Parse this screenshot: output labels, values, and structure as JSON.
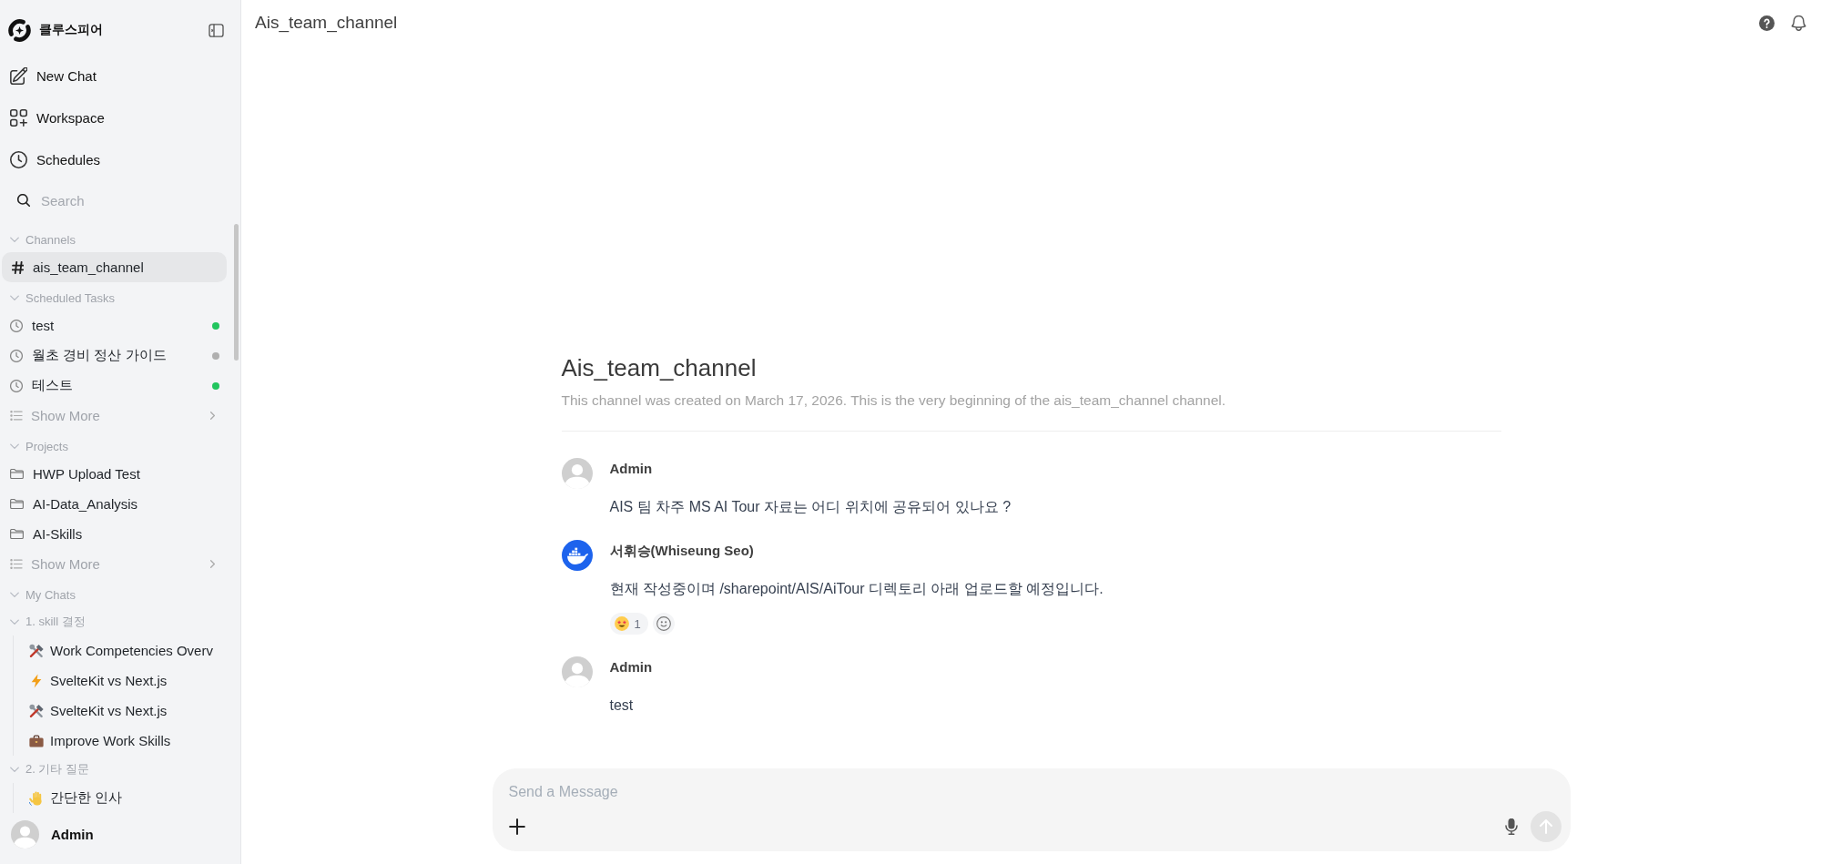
{
  "sidebar": {
    "brand": "클루스피어",
    "nav": [
      {
        "label": "New Chat",
        "kind": "new_chat"
      },
      {
        "label": "Workspace",
        "kind": "workspace"
      },
      {
        "label": "Schedules",
        "kind": "schedules"
      }
    ],
    "search": {
      "placeholder": "Search"
    },
    "sections": [
      {
        "kind": "channels",
        "title": "Channels",
        "expanded": true,
        "items": [
          {
            "label": "ais_team_channel",
            "selected": true
          }
        ]
      },
      {
        "kind": "tasks",
        "title": "Scheduled Tasks",
        "expanded": true,
        "items": [
          {
            "label": "test",
            "color": "#22c55e",
            "selected": false
          },
          {
            "label": "월초 경비 정산 가이드",
            "color": "#b0b0b0",
            "selected": false
          },
          {
            "label": "테스트",
            "color": "#22c55e",
            "selected": false
          }
        ],
        "more": "Show More"
      },
      {
        "kind": "projects",
        "title": "Projects",
        "expanded": true,
        "items": [
          {
            "label": "HWP Upload Test",
            "selected": false
          },
          {
            "label": "AI-Data_Analysis",
            "selected": false
          },
          {
            "label": "AI-Skills",
            "selected": false
          }
        ],
        "more": "Show More"
      },
      {
        "kind": "chats",
        "title": "My Chats",
        "expanded": true,
        "folders": [
          {
            "title": "1. skill 결정",
            "expanded": true,
            "items": [
              {
                "label": "Work Competencies Overv",
                "kind": "tools",
                "selected": false
              },
              {
                "label": "SvelteKit vs Next.js",
                "kind": "bolt",
                "selected": false
              },
              {
                "label": "SvelteKit vs Next.js",
                "kind": "tools",
                "selected": false
              },
              {
                "label": "Improve Work Skills",
                "kind": "briefcase",
                "selected": false
              }
            ]
          },
          {
            "title": "2. 기타 질문",
            "expanded": true,
            "items": [
              {
                "label": "간단한 인사",
                "kind": "wave",
                "selected": false
              }
            ]
          }
        ]
      }
    ],
    "user": {
      "name": "Admin"
    }
  },
  "header": {
    "title": "Ais_team_channel"
  },
  "channel_intro": {
    "title": "Ais_team_channel",
    "description": "This channel was created on March 17, 2026. This is the very beginning of the ais_team_channel channel."
  },
  "messages": [
    {
      "kind": "default",
      "author": "Admin",
      "text": "AIS 팀 차주 MS AI Tour 자료는 어디 위치에 공유되어 있나요 ?"
    },
    {
      "kind": "whale",
      "author": "서휘승(Whiseung Seo)",
      "text": "현재 작성중이며 /sharepoint/AIS/AiTour 디렉토리 아래 업로드할 예정입니다.",
      "reactions": [
        {
          "kind": "star_struck",
          "count": "1"
        }
      ]
    },
    {
      "kind": "default",
      "author": "Admin",
      "text": "test"
    }
  ],
  "composer": {
    "placeholder": "Send a Message",
    "send_disabled": true
  }
}
